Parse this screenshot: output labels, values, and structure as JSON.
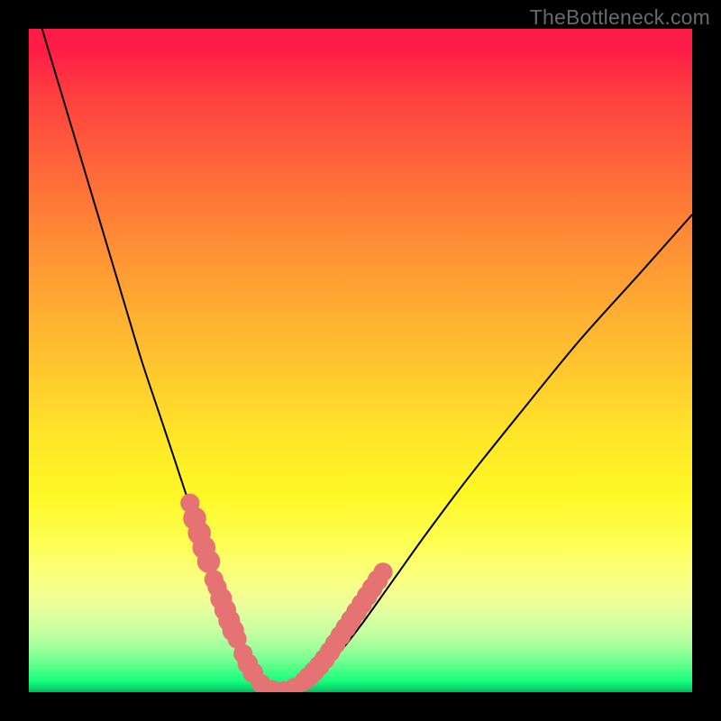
{
  "watermark": "TheBottleneck.com",
  "colors": {
    "curve": "#000000",
    "marker_fill": "#e57373",
    "marker_stroke": "#d86a6a",
    "frame": "#000000"
  },
  "chart_data": {
    "type": "line",
    "title": "",
    "xlabel": "",
    "ylabel": "",
    "xlim": [
      0,
      100
    ],
    "ylim": [
      0,
      100
    ],
    "grid": false,
    "legend": false,
    "series": [
      {
        "name": "bottleneck-curve",
        "x": [
          2,
          5,
          8,
          11,
          14,
          17,
          20,
          22,
          24,
          26,
          27.5,
          29,
          30.3,
          31.5,
          33,
          34,
          35.5,
          37.5,
          40,
          43,
          46,
          50,
          55,
          60,
          66,
          74,
          83,
          92,
          100
        ],
        "y": [
          100,
          90,
          80,
          70,
          60,
          50,
          41,
          35,
          29,
          23.5,
          19,
          15,
          12,
          9,
          5.5,
          3,
          1.2,
          0.2,
          0.5,
          2,
          5,
          10,
          17,
          24,
          32,
          42,
          53,
          63,
          72
        ]
      }
    ],
    "markers": [
      {
        "name": "marker-cluster",
        "color": "#e57373",
        "points": [
          {
            "x": 24.3,
            "y": 28.5,
            "r": 0.9
          },
          {
            "x": 25.0,
            "y": 26.2,
            "r": 1.2
          },
          {
            "x": 25.7,
            "y": 24.0,
            "r": 1.2
          },
          {
            "x": 26.4,
            "y": 21.8,
            "r": 1.2
          },
          {
            "x": 27.1,
            "y": 19.7,
            "r": 1.2
          },
          {
            "x": 27.9,
            "y": 17.0,
            "r": 0.9
          },
          {
            "x": 28.4,
            "y": 15.8,
            "r": 0.9
          },
          {
            "x": 29.0,
            "y": 14.1,
            "r": 1.1
          },
          {
            "x": 29.6,
            "y": 12.4,
            "r": 1.1
          },
          {
            "x": 30.2,
            "y": 10.8,
            "r": 1.1
          },
          {
            "x": 30.8,
            "y": 9.3,
            "r": 1.1
          },
          {
            "x": 31.4,
            "y": 8.0,
            "r": 0.9
          },
          {
            "x": 32.3,
            "y": 5.8,
            "r": 0.9
          },
          {
            "x": 33.0,
            "y": 4.3,
            "r": 1.0
          },
          {
            "x": 33.8,
            "y": 2.9,
            "r": 1.0
          },
          {
            "x": 35.0,
            "y": 1.3,
            "r": 0.9
          },
          {
            "x": 36.6,
            "y": 0.4,
            "r": 0.9
          },
          {
            "x": 38.4,
            "y": 0.2,
            "r": 0.9
          },
          {
            "x": 40.0,
            "y": 0.7,
            "r": 0.9
          },
          {
            "x": 41.4,
            "y": 1.6,
            "r": 0.9
          },
          {
            "x": 42.2,
            "y": 2.3,
            "r": 1.0
          },
          {
            "x": 43.0,
            "y": 3.1,
            "r": 1.0
          },
          {
            "x": 43.8,
            "y": 4.0,
            "r": 1.0
          },
          {
            "x": 44.6,
            "y": 5.0,
            "r": 1.0
          },
          {
            "x": 45.4,
            "y": 6.1,
            "r": 1.0
          },
          {
            "x": 46.2,
            "y": 7.3,
            "r": 1.0
          },
          {
            "x": 47.0,
            "y": 8.5,
            "r": 1.0
          },
          {
            "x": 47.8,
            "y": 9.7,
            "r": 1.0
          },
          {
            "x": 48.6,
            "y": 10.9,
            "r": 1.0
          },
          {
            "x": 49.4,
            "y": 12.1,
            "r": 1.0
          },
          {
            "x": 50.2,
            "y": 13.3,
            "r": 1.0
          },
          {
            "x": 51.0,
            "y": 14.5,
            "r": 1.0
          },
          {
            "x": 51.8,
            "y": 15.7,
            "r": 1.0
          },
          {
            "x": 52.6,
            "y": 16.9,
            "r": 1.0
          },
          {
            "x": 53.4,
            "y": 18.1,
            "r": 0.9
          }
        ]
      }
    ]
  }
}
